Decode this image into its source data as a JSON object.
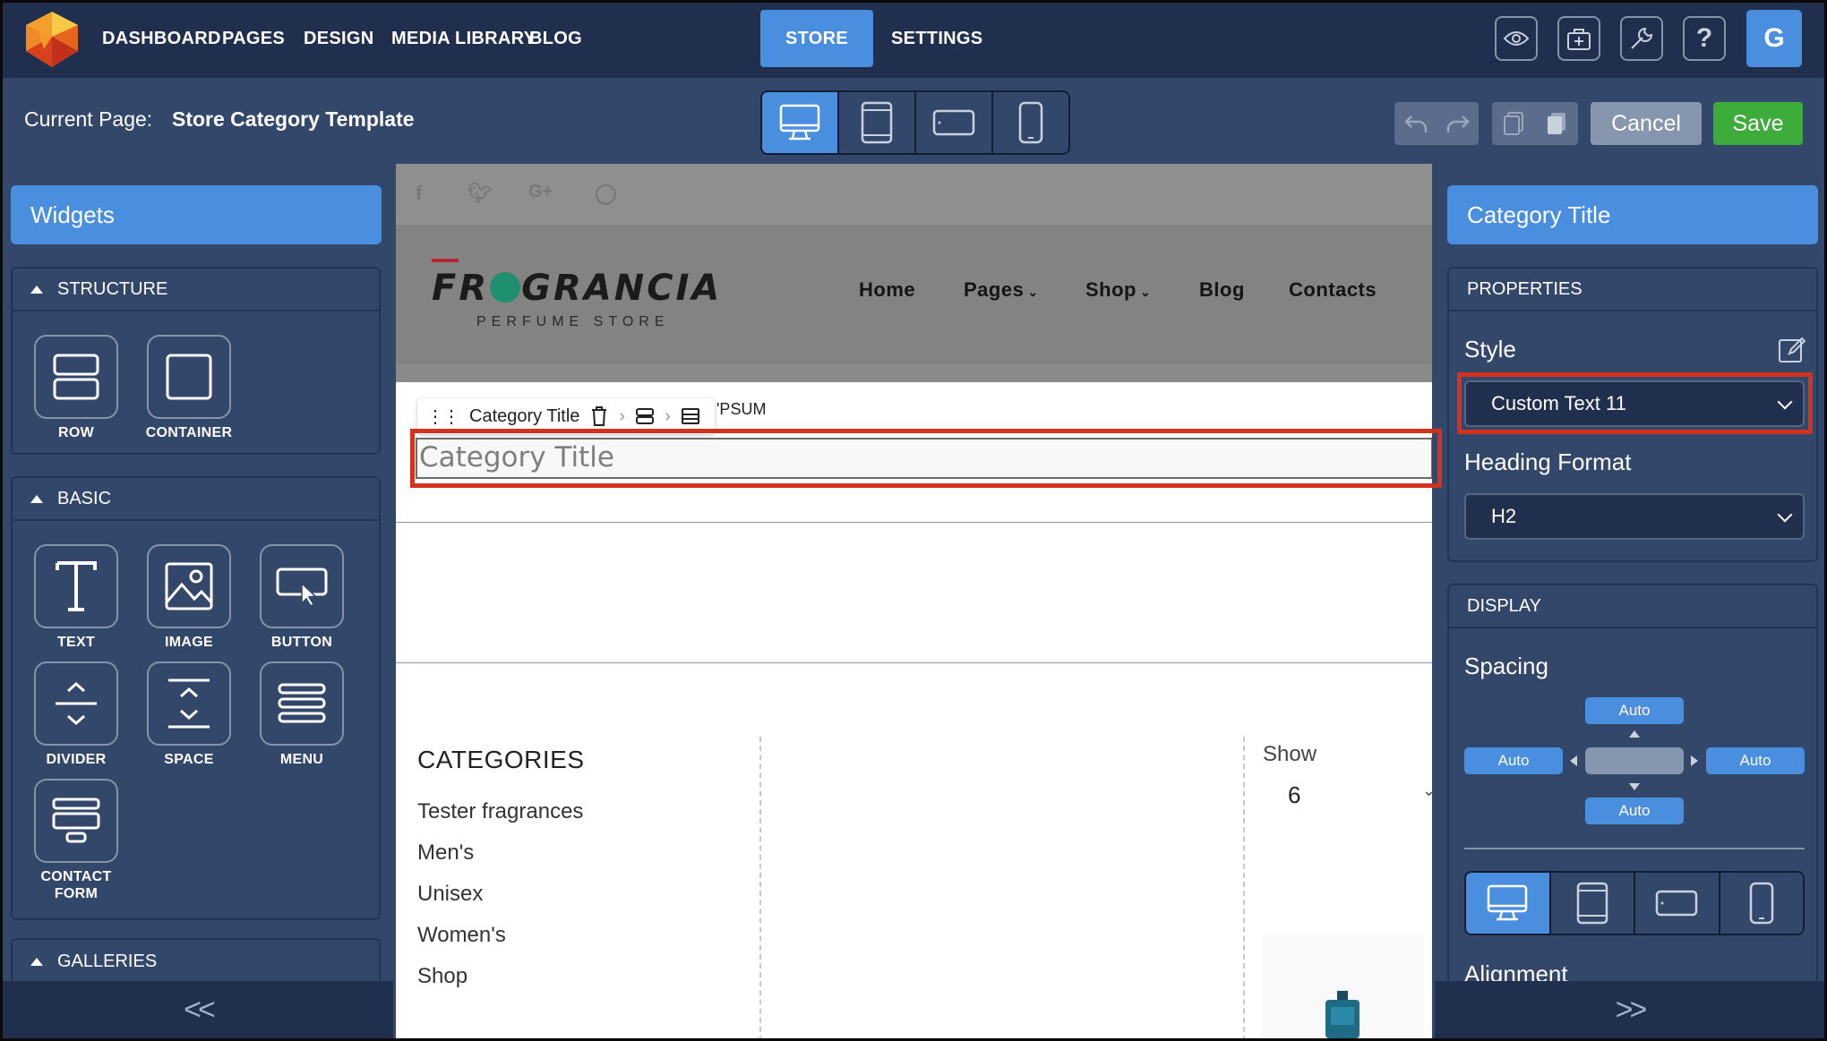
{
  "topnav": {
    "items": [
      "DASHBOARD",
      "PAGES",
      "DESIGN",
      "MEDIA LIBRARY",
      "BLOG",
      "STORE",
      "SETTINGS"
    ],
    "active": "STORE",
    "user_initial": "G"
  },
  "pagebar": {
    "current_page_label": "Current Page:",
    "current_page_value": "Store Category Template",
    "cancel_label": "Cancel",
    "save_label": "Save"
  },
  "left_panel": {
    "title": "Widgets",
    "structure": {
      "heading": "STRUCTURE",
      "widgets": [
        "ROW",
        "CONTAINER"
      ]
    },
    "basic": {
      "heading": "BASIC",
      "widgets": [
        "TEXT",
        "IMAGE",
        "BUTTON",
        "DIVIDER",
        "SPACE",
        "MENU",
        "CONTACT FORM"
      ],
      "contact_line1": "CONTACT",
      "contact_line2": "FORM"
    },
    "galleries": {
      "heading": "GALLERIES"
    },
    "collapse_label": "<<"
  },
  "canvas": {
    "brand": {
      "pre": "FR",
      "post": "GRANCIA",
      "tagline": "PERFUME STORE"
    },
    "menu": [
      "Home",
      "Pages",
      "Shop",
      "Blog",
      "Contacts"
    ],
    "widget_toolbar_label": "Category Title",
    "hidden_text_fragment": "'PSUM",
    "category_title": "Category Title",
    "categories": {
      "heading": "CATEGORIES",
      "items": [
        "Tester fragrances",
        "Men's",
        "Unisex",
        "Women's",
        "Shop"
      ]
    },
    "show": {
      "label": "Show",
      "value": "6"
    }
  },
  "right_panel": {
    "title": "Category Title",
    "properties": {
      "heading": "PROPERTIES",
      "style_label": "Style",
      "style_value": "Custom Text 11",
      "heading_format_label": "Heading Format",
      "heading_format_value": "H2"
    },
    "display": {
      "heading": "DISPLAY",
      "spacing_label": "Spacing",
      "spacing": {
        "top": "Auto",
        "left": "Auto",
        "right": "Auto",
        "bottom": "Auto"
      },
      "alignment_label": "Alignment"
    },
    "expand_label": ">>"
  },
  "colors": {
    "accent": "#4a8ee0",
    "nav_bg": "#1f2f4d",
    "panel_bg": "#33476a",
    "save_green": "#3dac3a",
    "highlight_red": "#d2321e"
  },
  "icons": [
    "logo-icon",
    "preview-eye-icon",
    "store-add-icon",
    "wrench-icon",
    "help-icon",
    "desktop-icon",
    "tablet-icon",
    "tablet-landscape-icon",
    "mobile-icon",
    "undo-icon",
    "redo-icon",
    "copy-icon",
    "paste-icon",
    "drag-handle-icon",
    "trash-icon",
    "facebook-icon",
    "twitter-icon",
    "google-plus-icon",
    "instagram-icon",
    "edit-style-icon"
  ]
}
